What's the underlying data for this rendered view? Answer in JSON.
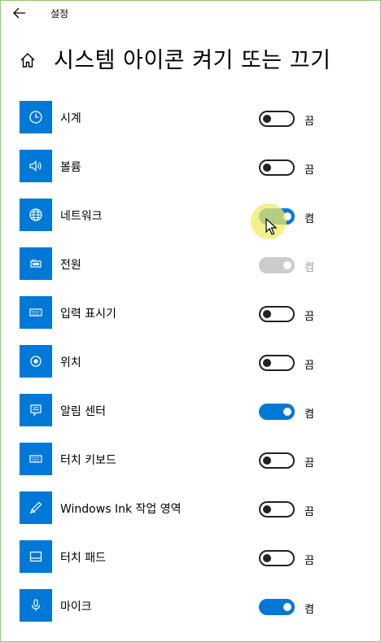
{
  "window": {
    "title": "설정"
  },
  "page": {
    "title": "시스템 아이콘 켜기 또는 끄기"
  },
  "items": [
    {
      "label": "시계",
      "icon": "clock-icon",
      "toggle": "off",
      "state_text": "끔"
    },
    {
      "label": "볼륨",
      "icon": "speaker-icon",
      "toggle": "off",
      "state_text": "끔"
    },
    {
      "label": "네트워크",
      "icon": "globe-icon",
      "toggle": "on",
      "state_text": "켬"
    },
    {
      "label": "전원",
      "icon": "battery-icon",
      "toggle": "disabled-on",
      "state_text": "켬"
    },
    {
      "label": "입력 표시기",
      "icon": "keyboard-icon",
      "toggle": "off",
      "state_text": "끔"
    },
    {
      "label": "위치",
      "icon": "location-icon",
      "toggle": "off",
      "state_text": "끔"
    },
    {
      "label": "알림 센터",
      "icon": "action-center-icon",
      "toggle": "on",
      "state_text": "켬"
    },
    {
      "label": "터치 키보드",
      "icon": "touch-keyboard-icon",
      "toggle": "off",
      "state_text": "끔"
    },
    {
      "label": "Windows Ink 작업 영역",
      "icon": "pen-icon",
      "toggle": "off",
      "state_text": "끔"
    },
    {
      "label": "터치 패드",
      "icon": "touchpad-icon",
      "toggle": "off",
      "state_text": "끔"
    },
    {
      "label": "마이크",
      "icon": "microphone-icon",
      "toggle": "on",
      "state_text": "켬"
    }
  ],
  "colors": {
    "accent": "#0078d7",
    "disabled": "#cccccc",
    "border": "#8fce6a",
    "highlight": "#f0eb64"
  }
}
